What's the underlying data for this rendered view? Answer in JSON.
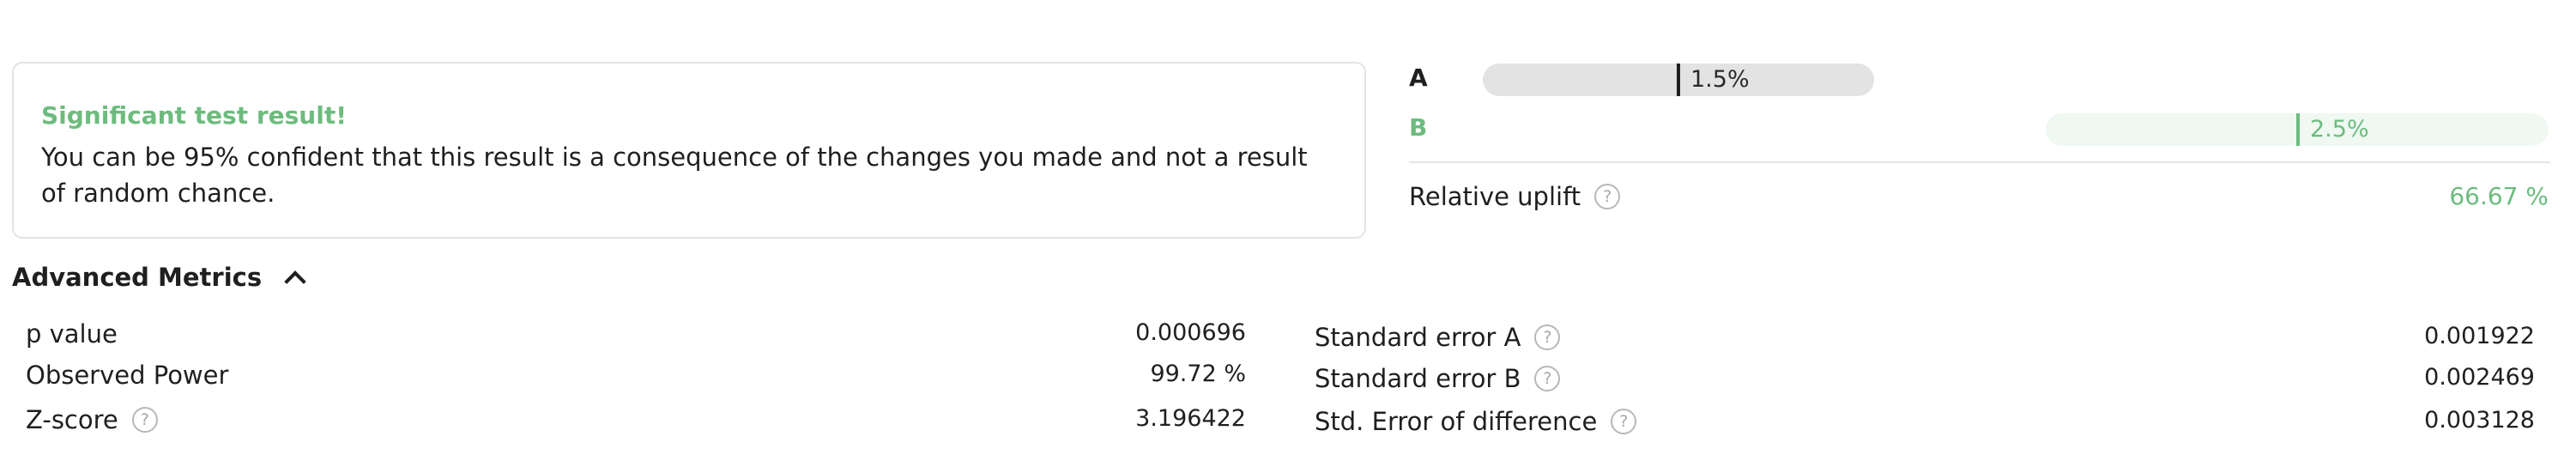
{
  "result": {
    "title": "Significant test result!",
    "message": "You can be 95% confident that this result is a consequence of the changes you made and not a result of random chance."
  },
  "variants": {
    "a": {
      "label": "A",
      "value": "1.5%",
      "rate": 0.015
    },
    "b": {
      "label": "B",
      "value": "2.5%",
      "rate": 0.025
    }
  },
  "uplift": {
    "label": "Relative uplift",
    "value": "66.67 %"
  },
  "advanced": {
    "title": "Advanced Metrics",
    "left": [
      {
        "label": "p value",
        "value": "0.000696"
      },
      {
        "label": "Observed Power",
        "value": "99.72 %"
      },
      {
        "label": "Z-score",
        "value": "3.196422"
      }
    ],
    "right": [
      {
        "label": "Standard error A",
        "value": "0.001922"
      },
      {
        "label": "Standard error B",
        "value": "0.002469"
      },
      {
        "label": "Std. Error of difference",
        "value": "0.003128"
      }
    ]
  },
  "colors": {
    "accent_green": "#6dbb7e",
    "bar_a_track": "#e3e3e3",
    "bar_b_track": "#eff8f1",
    "text": "#1f1f1f"
  },
  "icons": {
    "help": "?"
  }
}
